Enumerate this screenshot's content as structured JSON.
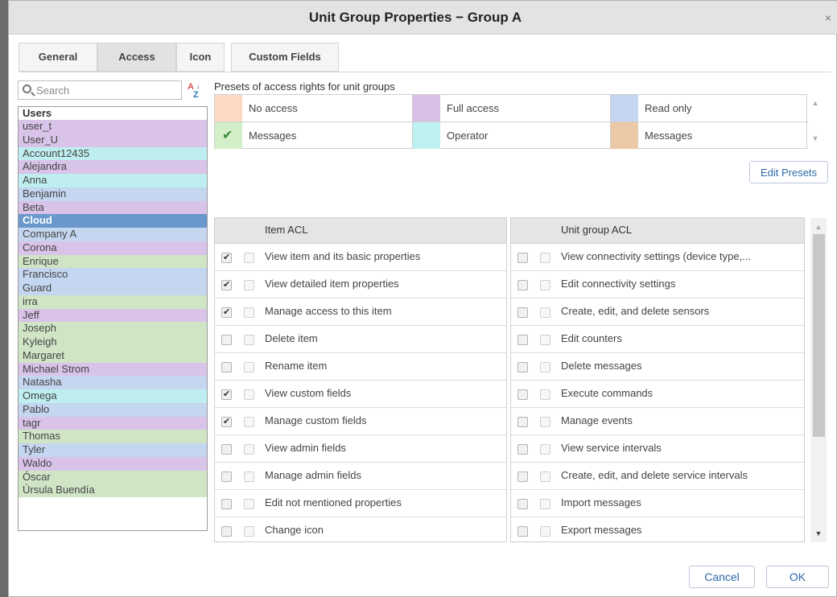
{
  "window": {
    "title": "Unit Group Properties − Group A",
    "close_label": "×"
  },
  "tabs": [
    {
      "label": "General",
      "active": false
    },
    {
      "label": "Access",
      "active": true
    },
    {
      "label": "Icon",
      "active": false
    },
    {
      "label": "Custom Fields",
      "active": false
    }
  ],
  "search": {
    "placeholder": "Search",
    "value": ""
  },
  "sort": {
    "a": "A",
    "z": "Z",
    "arrow": "↓"
  },
  "users": {
    "header": "Users",
    "items": [
      {
        "name": "user_t",
        "color": "#d9c3e8"
      },
      {
        "name": "User_U",
        "color": "#d9c3e8"
      },
      {
        "name": "Account12435",
        "color": "#bfeef0"
      },
      {
        "name": "Alejandra",
        "color": "#d9c3e8"
      },
      {
        "name": "Anna",
        "color": "#bfeef0"
      },
      {
        "name": "Benjamin",
        "color": "#c4d6f0"
      },
      {
        "name": "Beta",
        "color": "#d9c3e8"
      },
      {
        "name": "Cloud",
        "color": "#6a98cc",
        "selected": true
      },
      {
        "name": "Company A",
        "color": "#c4d6f0"
      },
      {
        "name": "Corona",
        "color": "#d9c3e8"
      },
      {
        "name": "Enrique",
        "color": "#cfe5c6"
      },
      {
        "name": "Francisco",
        "color": "#c4d6f0"
      },
      {
        "name": "Guard",
        "color": "#c4d6f0"
      },
      {
        "name": "irra",
        "color": "#cfe5c6"
      },
      {
        "name": "Jeff",
        "color": "#d9c3e8"
      },
      {
        "name": "Joseph",
        "color": "#cfe5c6"
      },
      {
        "name": "Kyleigh",
        "color": "#cfe5c6"
      },
      {
        "name": "Margaret",
        "color": "#cfe5c6"
      },
      {
        "name": "Michael Strom",
        "color": "#d9c3e8"
      },
      {
        "name": "Natasha",
        "color": "#c4d6f0"
      },
      {
        "name": "Omega",
        "color": "#bfeef0"
      },
      {
        "name": "Pablo",
        "color": "#c4d6f0"
      },
      {
        "name": "tagr",
        "color": "#d9c3e8"
      },
      {
        "name": "Thomas",
        "color": "#cfe5c6"
      },
      {
        "name": "Tyler",
        "color": "#c4d6f0"
      },
      {
        "name": "Waldo",
        "color": "#d9c3e8"
      },
      {
        "name": "Óscar",
        "color": "#cfe5c6"
      },
      {
        "name": "Úrsula Buendía",
        "color": "#cfe5c6"
      }
    ]
  },
  "presets": {
    "title": "Presets of access rights for unit groups",
    "items": [
      {
        "label": "No access",
        "color": "#fcd9c3",
        "checked": false
      },
      {
        "label": "Full access",
        "color": "#d7bfe6",
        "checked": false
      },
      {
        "label": "Read only",
        "color": "#c4d6f0",
        "checked": false
      },
      {
        "label": "Messages",
        "color": "#d3eec8",
        "checked": true
      },
      {
        "label": "Operator",
        "color": "#bff0f0",
        "checked": false
      },
      {
        "label": "Messages",
        "color": "#ecc9a6",
        "checked": false
      }
    ],
    "edit_label": "Edit Presets"
  },
  "item_acl": {
    "header": "Item ACL",
    "rows": [
      {
        "label": "View item and its basic properties",
        "checked": true
      },
      {
        "label": "View detailed item properties",
        "checked": true
      },
      {
        "label": "Manage access to this item",
        "checked": true
      },
      {
        "label": "Delete item",
        "checked": false
      },
      {
        "label": "Rename item",
        "checked": false
      },
      {
        "label": "View custom fields",
        "checked": true
      },
      {
        "label": "Manage custom fields",
        "checked": true
      },
      {
        "label": "View admin fields",
        "checked": false
      },
      {
        "label": "Manage admin fields",
        "checked": false
      },
      {
        "label": "Edit not mentioned properties",
        "checked": false
      },
      {
        "label": "Change icon",
        "checked": false
      }
    ]
  },
  "unit_group_acl": {
    "header": "Unit group ACL",
    "rows": [
      {
        "label": "View connectivity settings (device type,...",
        "checked": false
      },
      {
        "label": "Edit connectivity settings",
        "checked": false
      },
      {
        "label": "Create, edit, and delete sensors",
        "checked": false
      },
      {
        "label": "Edit counters",
        "checked": false
      },
      {
        "label": "Delete messages",
        "checked": false
      },
      {
        "label": "Execute commands",
        "checked": false
      },
      {
        "label": "Manage events",
        "checked": false
      },
      {
        "label": "View service intervals",
        "checked": false
      },
      {
        "label": "Create, edit, and delete service intervals",
        "checked": false
      },
      {
        "label": "Import messages",
        "checked": false
      },
      {
        "label": "Export messages",
        "checked": false
      }
    ]
  },
  "scroll_arrows": {
    "up": "▲",
    "down": "▼"
  },
  "buttons": {
    "cancel": "Cancel",
    "ok": "OK"
  }
}
